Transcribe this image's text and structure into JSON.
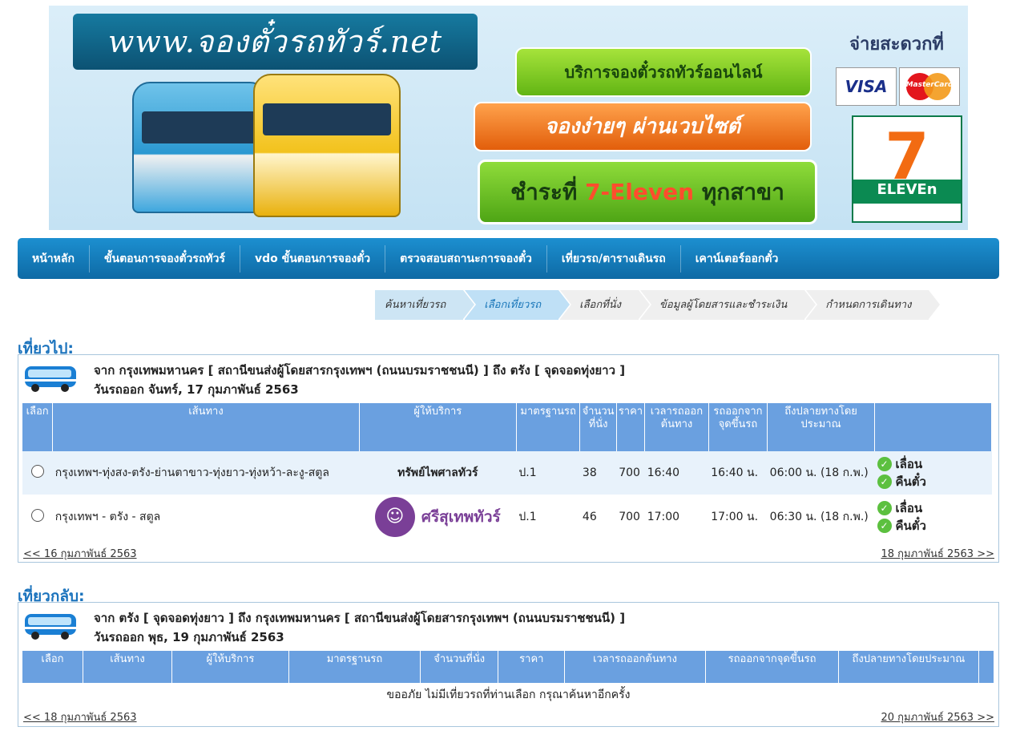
{
  "banner": {
    "site_url": "www.จองตั๋วรถทัวร์.net",
    "service": "บริการจองตั๋วรถทัวร์ออนไลน์",
    "easy": "จองง่ายๆ ผ่านเวบไซต์",
    "pay_prefix": "ชำระที่ ",
    "pay_store": "7-Eleven",
    "pay_suffix": " ทุกสาขา",
    "pay_convenient": "จ่ายสะดวกที่",
    "visa": "VISA",
    "mastercard": "MasterCard",
    "seven_num": "7",
    "seven_text": "ELEVEn"
  },
  "nav": {
    "items": [
      "หน้าหลัก",
      "ขั้นตอนการจองตั๋วรถทัวร์",
      "vdo ขั้นตอนการจองตั๋ว",
      "ตรวจสอบสถานะการจองตั๋ว",
      "เที่ยวรถ/ตารางเดินรถ",
      "เคาน์เตอร์ออกตั๋ว"
    ]
  },
  "steps": [
    "ค้นหาเที่ยวรถ",
    "เลือกเที่ยวรถ",
    "เลือกที่นั่ง",
    "ข้อมูลผู้โดยสารและชำระเงิน",
    "กำหนดการเดินทาง"
  ],
  "outbound": {
    "title": "เที่ยวไป:",
    "route": "จาก กรุงเทพมหานคร [ สถานีขนส่งผู้โดยสารกรุงเทพฯ (ถนนบรมราชชนนี) ] ถึง ตรัง [ จุดจอดทุ่งยาว ]",
    "date": "วันรถออก จันทร์, 17 กุมภาพันธ์ 2563",
    "headers": [
      "เลือก",
      "เส้นทาง",
      "ผู้ให้บริการ",
      "มาตรฐานรถ",
      "จำนวนที่นั่ง",
      "ราคา",
      "เวลารถออกต้นทาง",
      "รถออกจากจุดขึ้นรถ",
      "ถึงปลายทางโดยประมาณ",
      ""
    ],
    "rows": [
      {
        "route": "กรุงเทพฯ-ทุ่งสง-ตรัง-ย่านตาขาว-ทุ่งยาว-ทุ่งหว้า-ละงู-สตูล",
        "provider": "ทรัพย์ไพศาลทัวร์",
        "standard": "ป.1",
        "seats": "38",
        "price": "700",
        "depart": "16:40",
        "pickup": "16:40 น.",
        "arrive": "06:00 น. (18 ก.พ.)",
        "postpone": "เลื่อน",
        "refund": "คืนตั๋ว"
      },
      {
        "route": "กรุงเทพฯ - ตรัง - สตูล",
        "provider": "ศรีสุเทพทัวร์",
        "standard": "ป.1",
        "seats": "46",
        "price": "700",
        "depart": "17:00",
        "pickup": "17:00 น.",
        "arrive": "06:30 น. (18 ก.พ.)",
        "postpone": "เลื่อน",
        "refund": "คืนตั๋ว"
      }
    ],
    "prev": "<< 16 กุมภาพันธ์ 2563",
    "next": "18 กุมภาพันธ์ 2563 >>"
  },
  "return": {
    "title": "เที่ยวกลับ:",
    "route": "จาก ตรัง [ จุดจอดทุ่งยาว ] ถึง กรุงเทพมหานคร [ สถานีขนส่งผู้โดยสารกรุงเทพฯ (ถนนบรมราชชนนี) ]",
    "date": "วันรถออก พุธ, 19 กุมภาพันธ์ 2563",
    "headers": [
      "เลือก",
      "เส้นทาง",
      "ผู้ให้บริการ",
      "มาตรฐานรถ",
      "จำนวนที่นั่ง",
      "ราคา",
      "เวลารถออกต้นทาง",
      "รถออกจากจุดขึ้นรถ",
      "ถึงปลายทางโดยประมาณ",
      ""
    ],
    "empty": "ขออภัย ไม่มีเที่ยวรถที่ท่านเลือก กรุณาค้นหาอีกครั้ง",
    "prev": "<< 18 กุมภาพันธ์ 2563",
    "next": "20 กุมภาพันธ์ 2563 >>"
  }
}
